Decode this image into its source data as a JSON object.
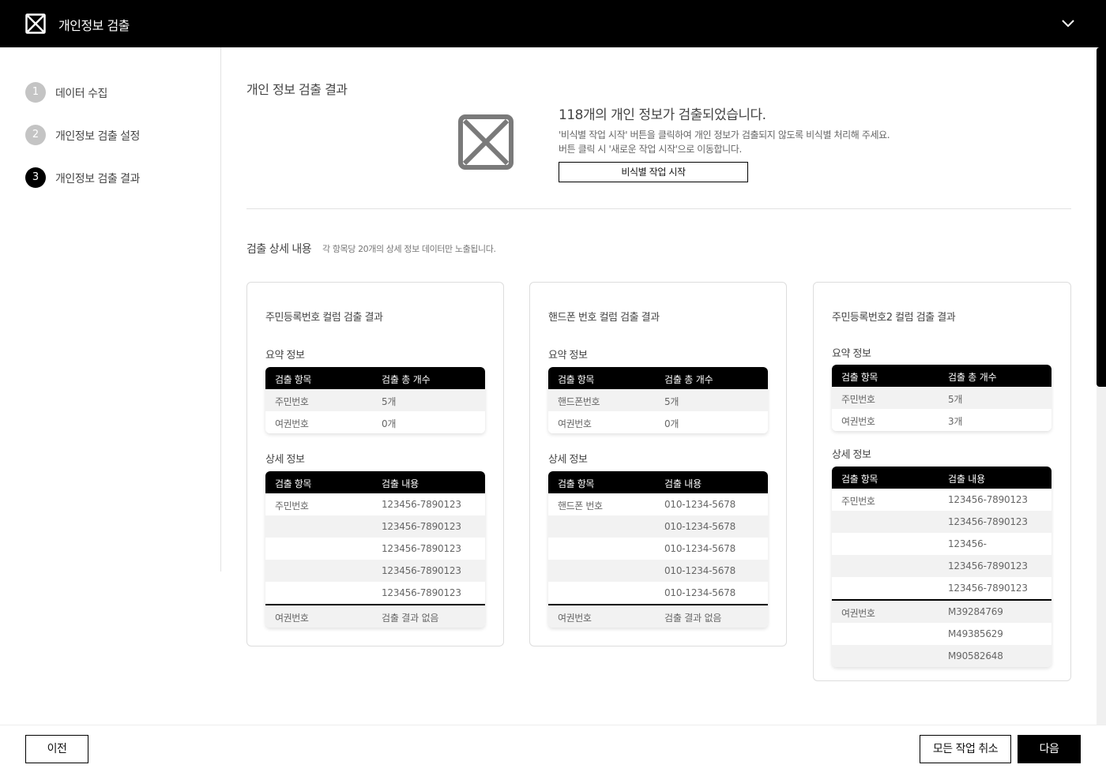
{
  "header": {
    "title": "개인정보 검출",
    "logo_icon": "close-box-icon",
    "collapse_icon": "chevron-down-icon"
  },
  "steps": [
    {
      "num": "1",
      "label": "데이터 수집",
      "active": false
    },
    {
      "num": "2",
      "label": "개인정보 검출 설정",
      "active": false
    },
    {
      "num": "3",
      "label": "개인정보 검출 결과",
      "active": true
    }
  ],
  "main": {
    "section_title": "개인 정보 검출 결과",
    "result": {
      "headline": "118개의 개인 정보가 검출되었습니다.",
      "desc_line1": "'비식별 작업 시작' 버튼을 클릭하여 개인 정보가 검출되지 않도록 비식별 처리해 주세요.",
      "desc_line2": "버튼 클릭 시 '새로운 작업 시작'으로 이동합니다.",
      "start_button": "비식별 작업 시작"
    },
    "detail": {
      "title": "검출 상세 내용",
      "note": "각 항목당 20개의 상세 정보 데이터만 노출됩니다."
    },
    "cards": [
      {
        "title": "주민등록번호 컬럼 검출 결과",
        "summary_title": "요약 정보",
        "summary_headers": [
          "검출 항목",
          "검출 총 개수"
        ],
        "summary_rows": [
          [
            "주민번호",
            "5개"
          ],
          [
            "여권번호",
            "0개"
          ]
        ],
        "detail_title": "상세 정보",
        "detail_headers": [
          "검출 항목",
          "검출 내용"
        ],
        "detail_rows": [
          [
            "주민번호",
            "123456-7890123"
          ],
          [
            "",
            "123456-7890123"
          ],
          [
            "",
            "123456-7890123"
          ],
          [
            "",
            "123456-7890123"
          ],
          [
            "",
            "123456-7890123"
          ],
          [
            "여권번호",
            "검출 결과 없음"
          ]
        ]
      },
      {
        "title": "핸드폰 번호 컬럼 검출 결과",
        "summary_title": "요약 정보",
        "summary_headers": [
          "검출 항목",
          "검출 총 개수"
        ],
        "summary_rows": [
          [
            "핸드폰번호",
            "5개"
          ],
          [
            "여권번호",
            "0개"
          ]
        ],
        "detail_title": "상세 정보",
        "detail_headers": [
          "검출 항목",
          "검출 내용"
        ],
        "detail_rows": [
          [
            "핸드폰 번호",
            "010-1234-5678"
          ],
          [
            "",
            "010-1234-5678"
          ],
          [
            "",
            "010-1234-5678"
          ],
          [
            "",
            "010-1234-5678"
          ],
          [
            "",
            "010-1234-5678"
          ],
          [
            "여권번호",
            "검출 결과 없음"
          ]
        ]
      },
      {
        "title": "주민등록번호2 컬럼 검출 결과",
        "summary_title": "요약 정보",
        "summary_headers": [
          "검출 항목",
          "검출 총 개수"
        ],
        "summary_rows": [
          [
            "주민번호",
            "5개"
          ],
          [
            "여권번호",
            "3개"
          ]
        ],
        "detail_title": "상세 정보",
        "detail_headers": [
          "검출 항목",
          "검출 내용"
        ],
        "detail_rows": [
          [
            "주민번호",
            "123456-7890123"
          ],
          [
            "",
            "123456-7890123"
          ],
          [
            "",
            "123456-"
          ],
          [
            "",
            "123456-7890123"
          ],
          [
            "",
            "123456-7890123"
          ],
          [
            "여권번호",
            "M39284769"
          ],
          [
            "",
            "M49385629"
          ],
          [
            "",
            "M90582648"
          ]
        ]
      }
    ]
  },
  "footer": {
    "prev": "이전",
    "cancel_all": "모든 작업 취소",
    "next": "다음"
  }
}
